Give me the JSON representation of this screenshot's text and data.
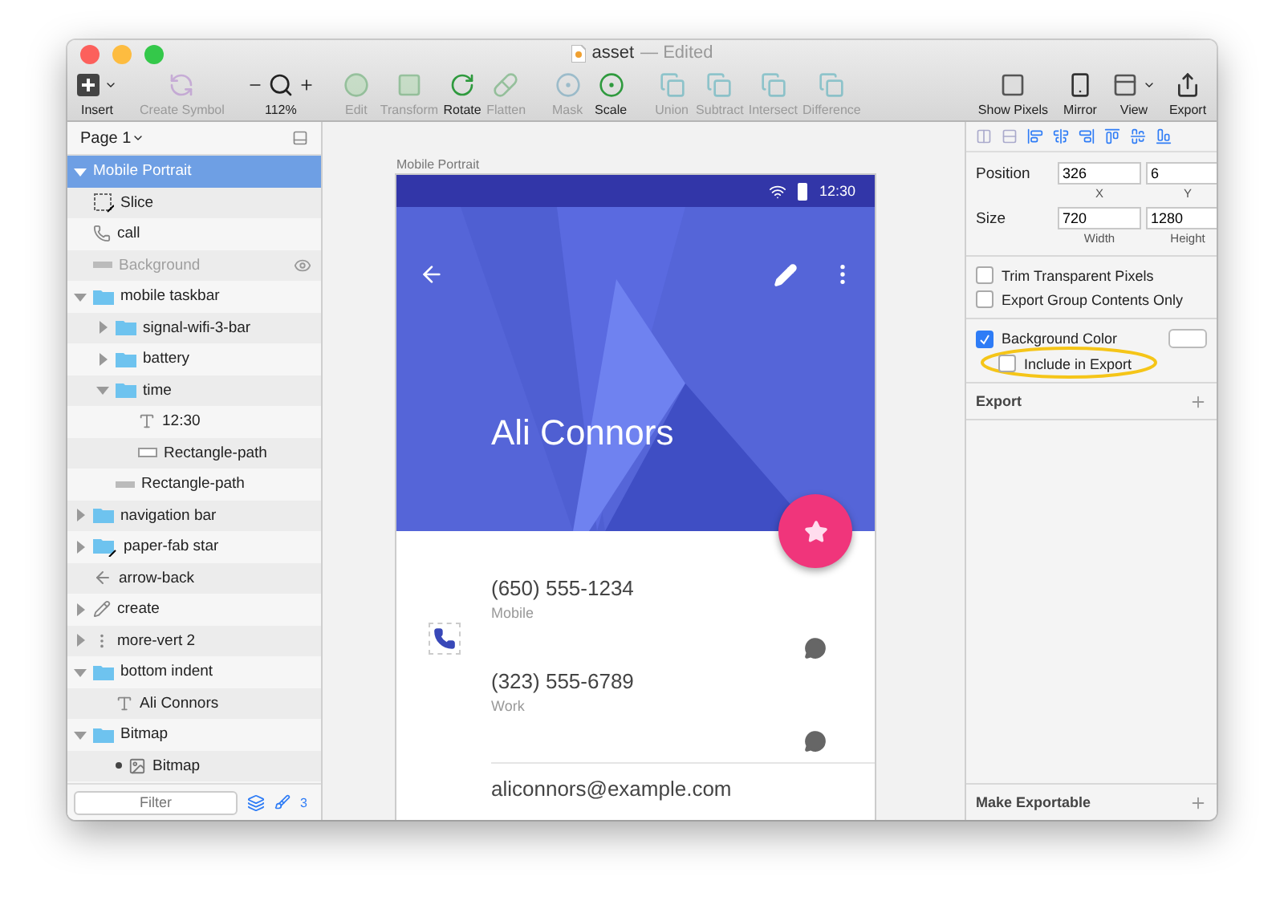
{
  "window": {
    "title": "asset",
    "status": "— Edited"
  },
  "toolbar": {
    "groups": [
      [
        {
          "kind": "insert",
          "label": "Insert",
          "disabled": false
        }
      ],
      [
        {
          "kind": "symbol",
          "label": "Create Symbol",
          "disabled": true
        }
      ],
      [
        {
          "kind": "zoom",
          "label": "112%",
          "disabled": false
        }
      ],
      [
        {
          "kind": "edit",
          "label": "Edit",
          "disabled": true
        },
        {
          "kind": "transform",
          "label": "Transform",
          "disabled": true
        },
        {
          "kind": "rotate",
          "label": "Rotate",
          "disabled": false
        },
        {
          "kind": "flatten",
          "label": "Flatten",
          "disabled": true
        }
      ],
      [
        {
          "kind": "mask",
          "label": "Mask",
          "disabled": true
        },
        {
          "kind": "scale",
          "label": "Scale",
          "disabled": false
        }
      ],
      [
        {
          "kind": "union",
          "label": "Union",
          "disabled": true
        },
        {
          "kind": "subtract",
          "label": "Subtract",
          "disabled": true
        },
        {
          "kind": "intersect",
          "label": "Intersect",
          "disabled": true
        },
        {
          "kind": "difference",
          "label": "Difference",
          "disabled": true
        }
      ],
      [
        {
          "kind": "pixels",
          "label": "Show Pixels",
          "disabled": false
        },
        {
          "kind": "mirror",
          "label": "Mirror",
          "disabled": false
        },
        {
          "kind": "view",
          "label": "View",
          "disabled": false
        },
        {
          "kind": "export",
          "label": "Export",
          "disabled": false
        }
      ]
    ]
  },
  "sidebar": {
    "page": "Page 1",
    "layers": [
      {
        "name": "Mobile Portrait",
        "expanded": true,
        "selected": true,
        "children": [
          {
            "name": "Slice",
            "kind": "slice",
            "selected": false
          },
          {
            "name": "call",
            "kind": "phone",
            "selected": false
          },
          {
            "name": "Background",
            "kind": "line",
            "hidden": true,
            "selected": false
          },
          {
            "name": "mobile taskbar",
            "kind": "folder",
            "expanded": true,
            "selected": false,
            "children": [
              {
                "name": "signal-wifi-3-bar",
                "kind": "folder",
                "expanded": false,
                "selected": false
              },
              {
                "name": "battery",
                "kind": "folder",
                "expanded": false,
                "selected": false
              },
              {
                "name": "time",
                "kind": "folder",
                "expanded": true,
                "selected": false,
                "children": [
                  {
                    "name": "12:30",
                    "kind": "text",
                    "selected": false
                  },
                  {
                    "name": "Rectangle-path",
                    "kind": "rectangle",
                    "selected": false
                  }
                ]
              },
              {
                "name": "Rectangle-path",
                "kind": "line",
                "selected": false
              }
            ]
          },
          {
            "name": "navigation bar",
            "kind": "folder",
            "expanded": false,
            "selected": false
          },
          {
            "name": "paper-fab star",
            "kind": "folder-slice",
            "expanded": false,
            "selected": false
          },
          {
            "name": "arrow-back",
            "kind": "arrow",
            "selected": false
          },
          {
            "name": "create",
            "kind": "pencil",
            "expanded": false,
            "selected": false
          },
          {
            "name": "more-vert 2",
            "kind": "dots",
            "expanded": false,
            "selected": false
          },
          {
            "name": "bottom indent",
            "kind": "folder",
            "expanded": true,
            "selected": false,
            "children": [
              {
                "name": "Ali Connors",
                "kind": "text",
                "selected": false
              }
            ]
          },
          {
            "name": "Bitmap",
            "kind": "folder",
            "expanded": true,
            "selected": false,
            "children": [
              {
                "name": "Bitmap",
                "kind": "bitmap",
                "selected": false
              }
            ]
          }
        ]
      }
    ],
    "filter": {
      "placeholder": "Filter"
    },
    "badge": "3"
  },
  "canvas": {
    "artboard_label": "Mobile Portrait",
    "phone": {
      "time": "12:30",
      "name": "Ali Connors",
      "contacts": [
        {
          "value": "(650) 555-1234",
          "label": "Mobile"
        },
        {
          "value": "(323) 555-6789",
          "label": "Work"
        }
      ],
      "email": "aliconnors@example.com"
    }
  },
  "inspector": {
    "position": {
      "label": "Position",
      "fields": [
        {
          "value": "326",
          "caption": "X"
        },
        {
          "value": "6",
          "caption": "Y"
        }
      ]
    },
    "size": {
      "label": "Size",
      "fields": [
        {
          "value": "720",
          "caption": "Width"
        },
        {
          "value": "1280",
          "caption": "Height"
        }
      ]
    },
    "options": [
      {
        "label": "Trim Transparent Pixels",
        "checked": false
      },
      {
        "label": "Export Group Contents Only",
        "checked": false
      }
    ],
    "background": {
      "label": "Background Color",
      "checked": true,
      "include": {
        "label": "Include in Export",
        "checked": false,
        "highlighted": true
      }
    },
    "export": {
      "title": "Export"
    },
    "footer": {
      "title": "Make Exportable"
    }
  }
}
